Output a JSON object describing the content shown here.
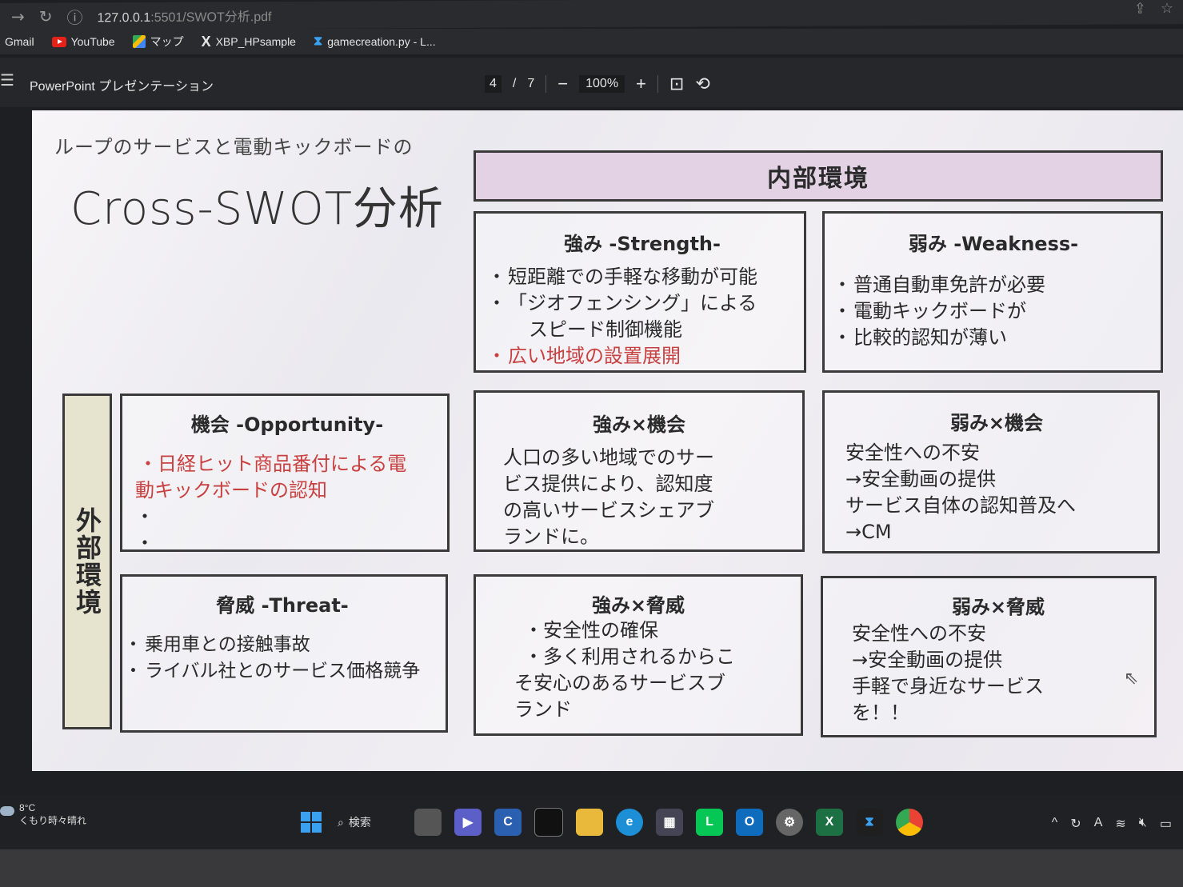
{
  "browser": {
    "url_host": "127.0.0.1",
    "url_path": ":5501/SWOT分析.pdf"
  },
  "bookmarks": [
    {
      "label": "Gmail"
    },
    {
      "label": "YouTube"
    },
    {
      "label": "マップ"
    },
    {
      "label": "XBP_HPsample"
    },
    {
      "label": "gamecreation.py - L..."
    }
  ],
  "pdf_toolbar": {
    "title": "PowerPoint プレゼンテーション",
    "page_current": "4",
    "page_sep": "/",
    "page_total": "7",
    "zoom_minus": "−",
    "zoom": "100%",
    "zoom_plus": "+"
  },
  "slide": {
    "subtitle": "ループのサービスと電動キックボードの",
    "title": "Cross-SWOT分析",
    "internal_label": "内部環境",
    "external_label": "外部環境",
    "strength": {
      "heading": "強み -Strength-",
      "items": [
        "短距離での手軽な移動が可能",
        "「ジオフェンシング」による",
        "広い地域の設置展開"
      ],
      "continuation": "スピード制御機能"
    },
    "weakness": {
      "heading": "弱み -Weakness-",
      "items": [
        "普通自動車免許が必要",
        "電動キックボードが"
      ],
      "continuation": "比較的認知が薄い"
    },
    "opportunity": {
      "heading": "機会 -Opportunity-",
      "item1": "・日経ヒット商品番付による電",
      "item1_cont": "動キックボードの認知",
      "empty_bullet": "・"
    },
    "threat": {
      "heading": "脅威 -Threat-",
      "items": [
        "乗用車との接触事故",
        "ライバル社とのサービス価格競争"
      ]
    },
    "so": {
      "heading": "強み×機会",
      "lines": [
        "人口の多い地域でのサー",
        "ビス提供により、認知度",
        "の高いサービスシェアブ",
        "ランドに。"
      ]
    },
    "wo": {
      "heading": "弱み×機会",
      "lines": [
        "安全性への不安",
        "→安全動画の提供",
        "サービス自体の認知普及へ",
        "→CM"
      ]
    },
    "st": {
      "heading": "強み×脅威",
      "lines": [
        "・安全性の確保",
        "・多く利用されるからこ",
        "そ安心のあるサービスブ",
        "ランド"
      ]
    },
    "wt": {
      "heading": "弱み×脅威",
      "lines": [
        "安全性への不安",
        "→安全動画の提供",
        "手軽で身近なサービス",
        "を！！"
      ]
    }
  },
  "taskbar": {
    "temperature": "8°C",
    "weather": "くもり時々晴れ",
    "search": "検索"
  },
  "colors": {
    "internal_fill": "#e3d2e4",
    "external_fill": "#e6e3cf",
    "highlight_text": "#c94040"
  }
}
